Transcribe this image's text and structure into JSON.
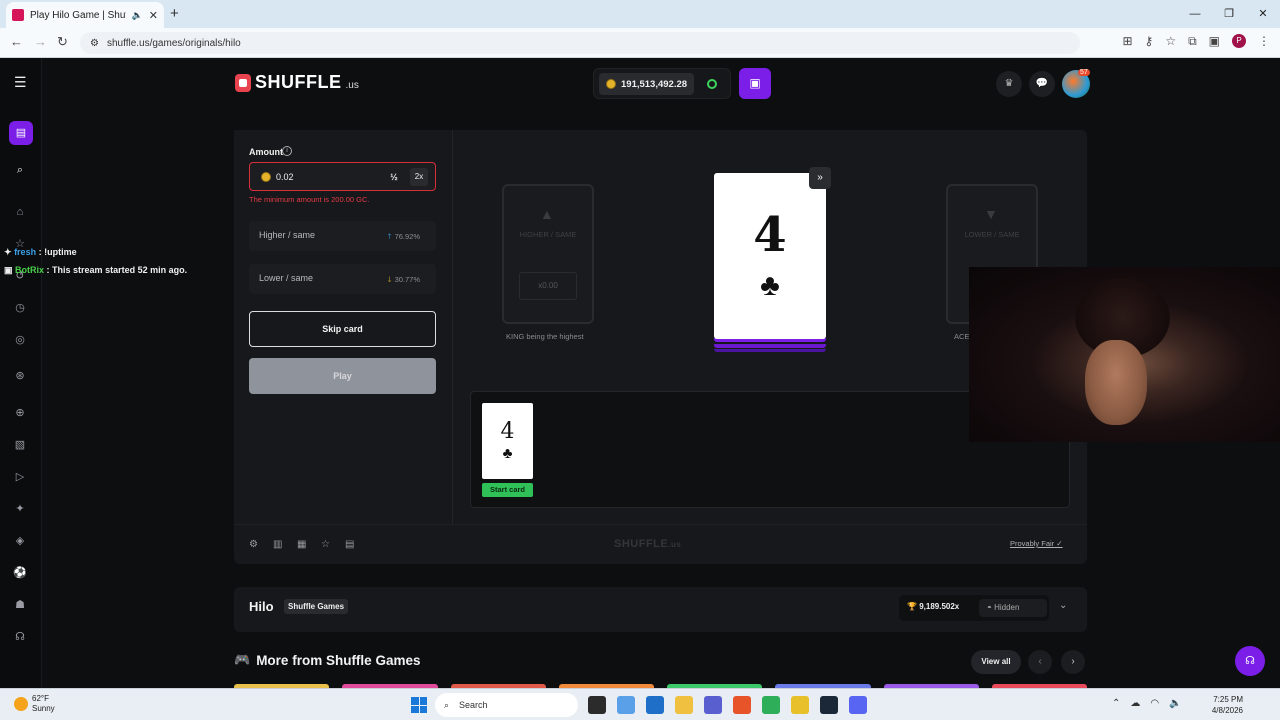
{
  "browser": {
    "tab_title": "Play Hilo Game | Shuffle.us",
    "url": "shuffle.us/games/originals/hilo",
    "profile_initial": "P"
  },
  "header": {
    "logo_text": "SHUFFLE",
    "logo_suffix": ".us",
    "balance": "191,513,492.28",
    "avatar_badge": "57"
  },
  "bet": {
    "amount_label": "Amount",
    "amount_value": "0.02",
    "half_label": "½",
    "double_label": "2x",
    "error": "The minimum amount is 200.00 GC."
  },
  "options": [
    {
      "label": "Higher / same",
      "pct": "76.92%",
      "dir": "up"
    },
    {
      "label": "Lower / same",
      "pct": "30.77%",
      "dir": "down"
    }
  ],
  "buttons": {
    "skip": "Skip card",
    "play": "Play",
    "skip_ff": "»"
  },
  "ghost_left": {
    "label": "HIGHER / SAME",
    "mult": "x0.00",
    "caption": "KING being the highest"
  },
  "ghost_right": {
    "label": "LOWER / SAME",
    "caption": "ACE"
  },
  "current_card": {
    "rank": "4",
    "suit": "♣"
  },
  "history": [
    {
      "rank": "4",
      "suit": "♣",
      "tag": "Start card"
    }
  ],
  "footer": {
    "logo": "SHUFFLE",
    "logo_suffix": ".us",
    "provably_fair": "Provably Fair"
  },
  "game_info": {
    "title": "Hilo",
    "tag": "Shuffle Games",
    "record": "9,189.502x",
    "hidden": "Hidden"
  },
  "more": {
    "title": "More from Shuffle Games",
    "view_all": "View all",
    "thumb_colors": [
      "#e8c04a",
      "#e04a9a",
      "#e05a4a",
      "#f08a3a",
      "#3ac86a",
      "#6a7ae8",
      "#9a5ae8",
      "#e84a5a"
    ]
  },
  "chat": [
    {
      "user": "fresh",
      "msg": ": !uptime",
      "color": "#3aa0e8"
    },
    {
      "user": "BotRix",
      "msg": ": This stream started 52 min ago.",
      "color": "#4ad04a"
    }
  ],
  "taskbar": {
    "temp": "62°F",
    "cond": "Sunny",
    "search": "Search",
    "time": "7:25 PM",
    "date": "4/8/2026"
  },
  "colors": {
    "accent": "#7a1ee8",
    "error": "#e63a45",
    "start_tag": "#2fc157"
  }
}
